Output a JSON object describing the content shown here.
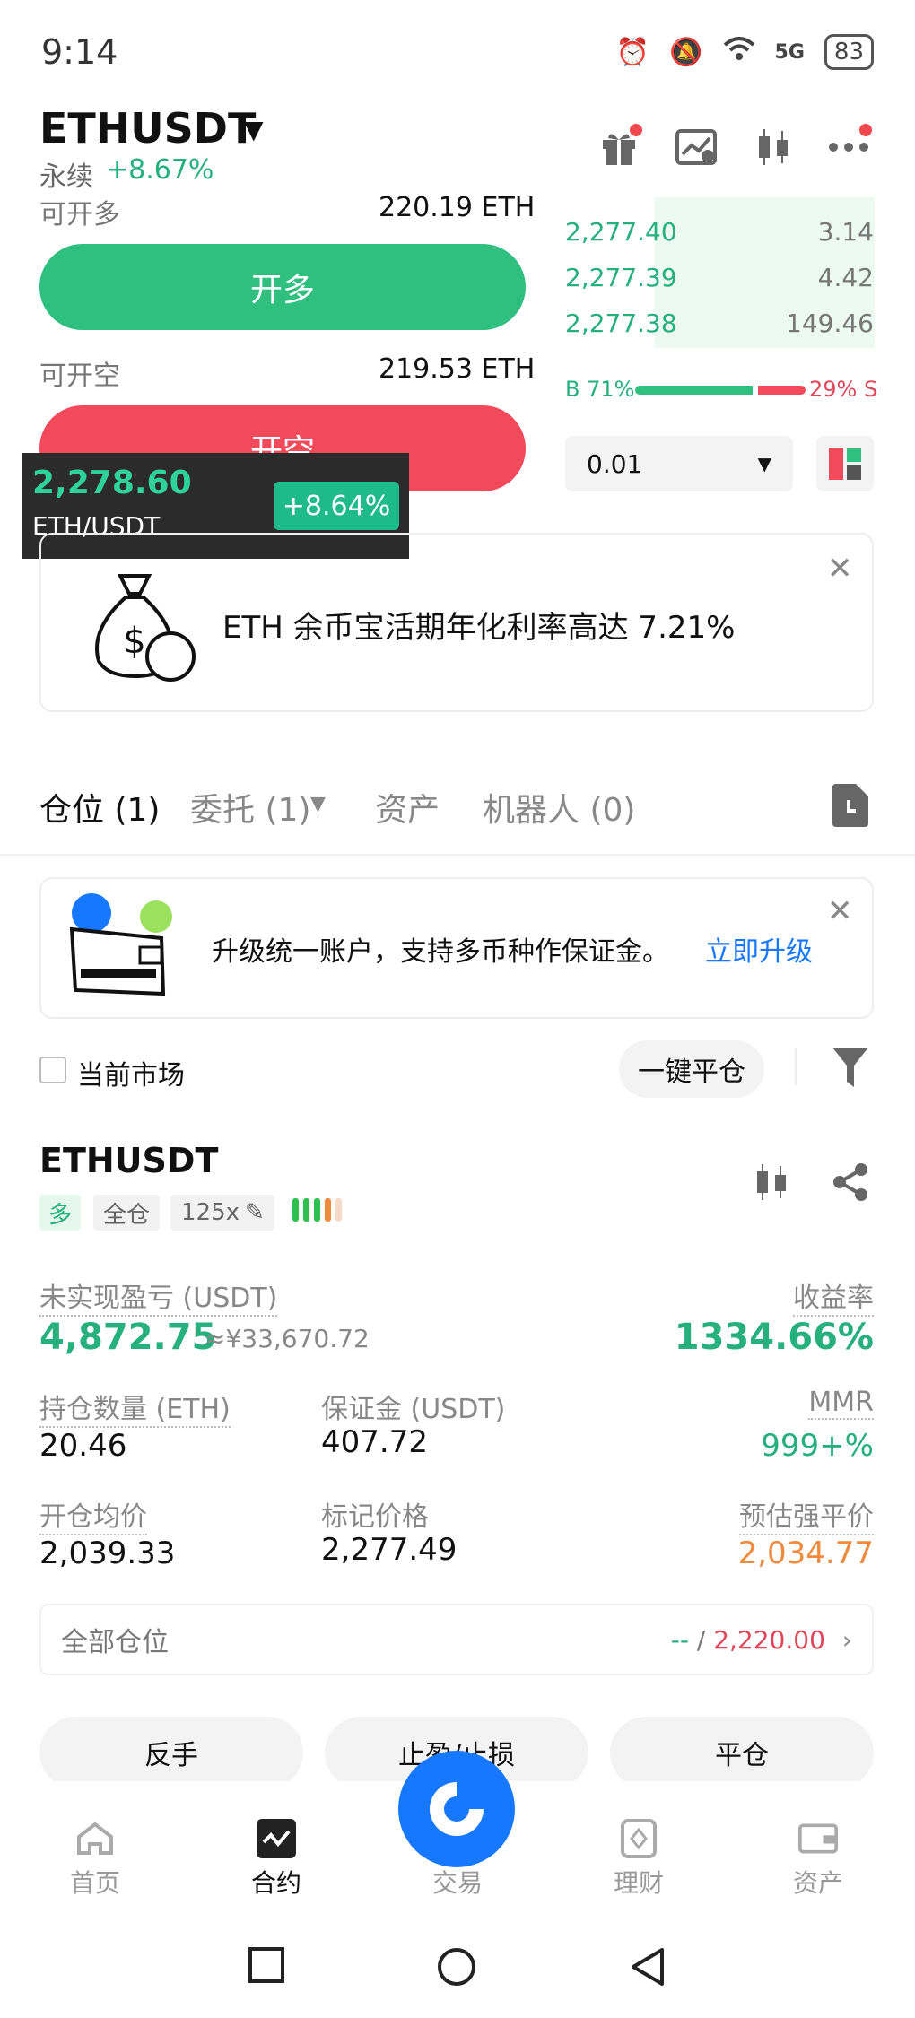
{
  "status_bar": {
    "time": "9:14",
    "battery": "83",
    "network": "5G"
  },
  "header": {
    "pair": "ETHUSDT",
    "contract_type": "永续",
    "change": "+8.67%",
    "icons": [
      "gift-icon",
      "chart-settings-icon",
      "candlestick-icon",
      "more-icon"
    ]
  },
  "trade": {
    "open_long_label": "可开多",
    "open_long_amount": "220.19 ETH",
    "long_button": "开多",
    "open_short_label": "可开空",
    "open_short_amount": "219.53 ETH",
    "short_button": "开空"
  },
  "price_overlay": {
    "price": "2,278.60",
    "pair": "ETH/USDT",
    "change": "+8.64%"
  },
  "order_book": {
    "rows": [
      {
        "price": "2,277.40",
        "qty": "3.14"
      },
      {
        "price": "2,277.39",
        "qty": "4.42"
      },
      {
        "price": "2,277.38",
        "qty": "149.46"
      }
    ],
    "buy_ratio_label": "B 71%",
    "sell_ratio_label": "29% S",
    "buy_ratio": 0.71,
    "precision": "0.01"
  },
  "promo_banner": {
    "text": "ETH 余币宝活期年化利率高达 7.21%"
  },
  "tabs": [
    {
      "label": "仓位 (1)"
    },
    {
      "label": "委托 (1)"
    },
    {
      "label": "资产"
    },
    {
      "label": "机器人 (0)"
    }
  ],
  "upgrade_banner": {
    "text": "升级统一账户，支持多币种作保证金。",
    "link": "立即升级"
  },
  "filter": {
    "current_market": "当前市场",
    "close_all": "一键平仓"
  },
  "position": {
    "symbol": "ETHUSDT",
    "side": "多",
    "margin_mode": "全仓",
    "leverage": "125x",
    "unrealized_pnl_label": "未实现盈亏 (USDT)",
    "unrealized_pnl": "4,872.75",
    "unrealized_pnl_cny": "≈¥33,670.72",
    "roi_label": "收益率",
    "roi": "1334.66%",
    "size_label": "持仓数量 (ETH)",
    "size": "20.46",
    "margin_label": "保证金 (USDT)",
    "margin": "407.72",
    "mmr_label": "MMR",
    "mmr": "999+%",
    "entry_label": "开仓均价",
    "entry": "2,039.33",
    "mark_label": "标记价格",
    "mark": "2,277.49",
    "liq_label": "预估强平价",
    "liq": "2,034.77"
  },
  "all_positions": {
    "label": "全部仓位",
    "value_a": "--",
    "value_sep": " / ",
    "value_b": "2,220.00"
  },
  "actions": {
    "reverse": "反手",
    "tp_sl": "止盈/止损",
    "close": "平仓"
  },
  "bottom_nav": [
    {
      "label": "首页"
    },
    {
      "label": "合约"
    },
    {
      "label": "交易"
    },
    {
      "label": "理财"
    },
    {
      "label": "资产"
    }
  ],
  "colors": {
    "green": "#25b07d",
    "red": "#f24a5b",
    "blue": "#1677ff",
    "orange": "#f08a3c"
  }
}
